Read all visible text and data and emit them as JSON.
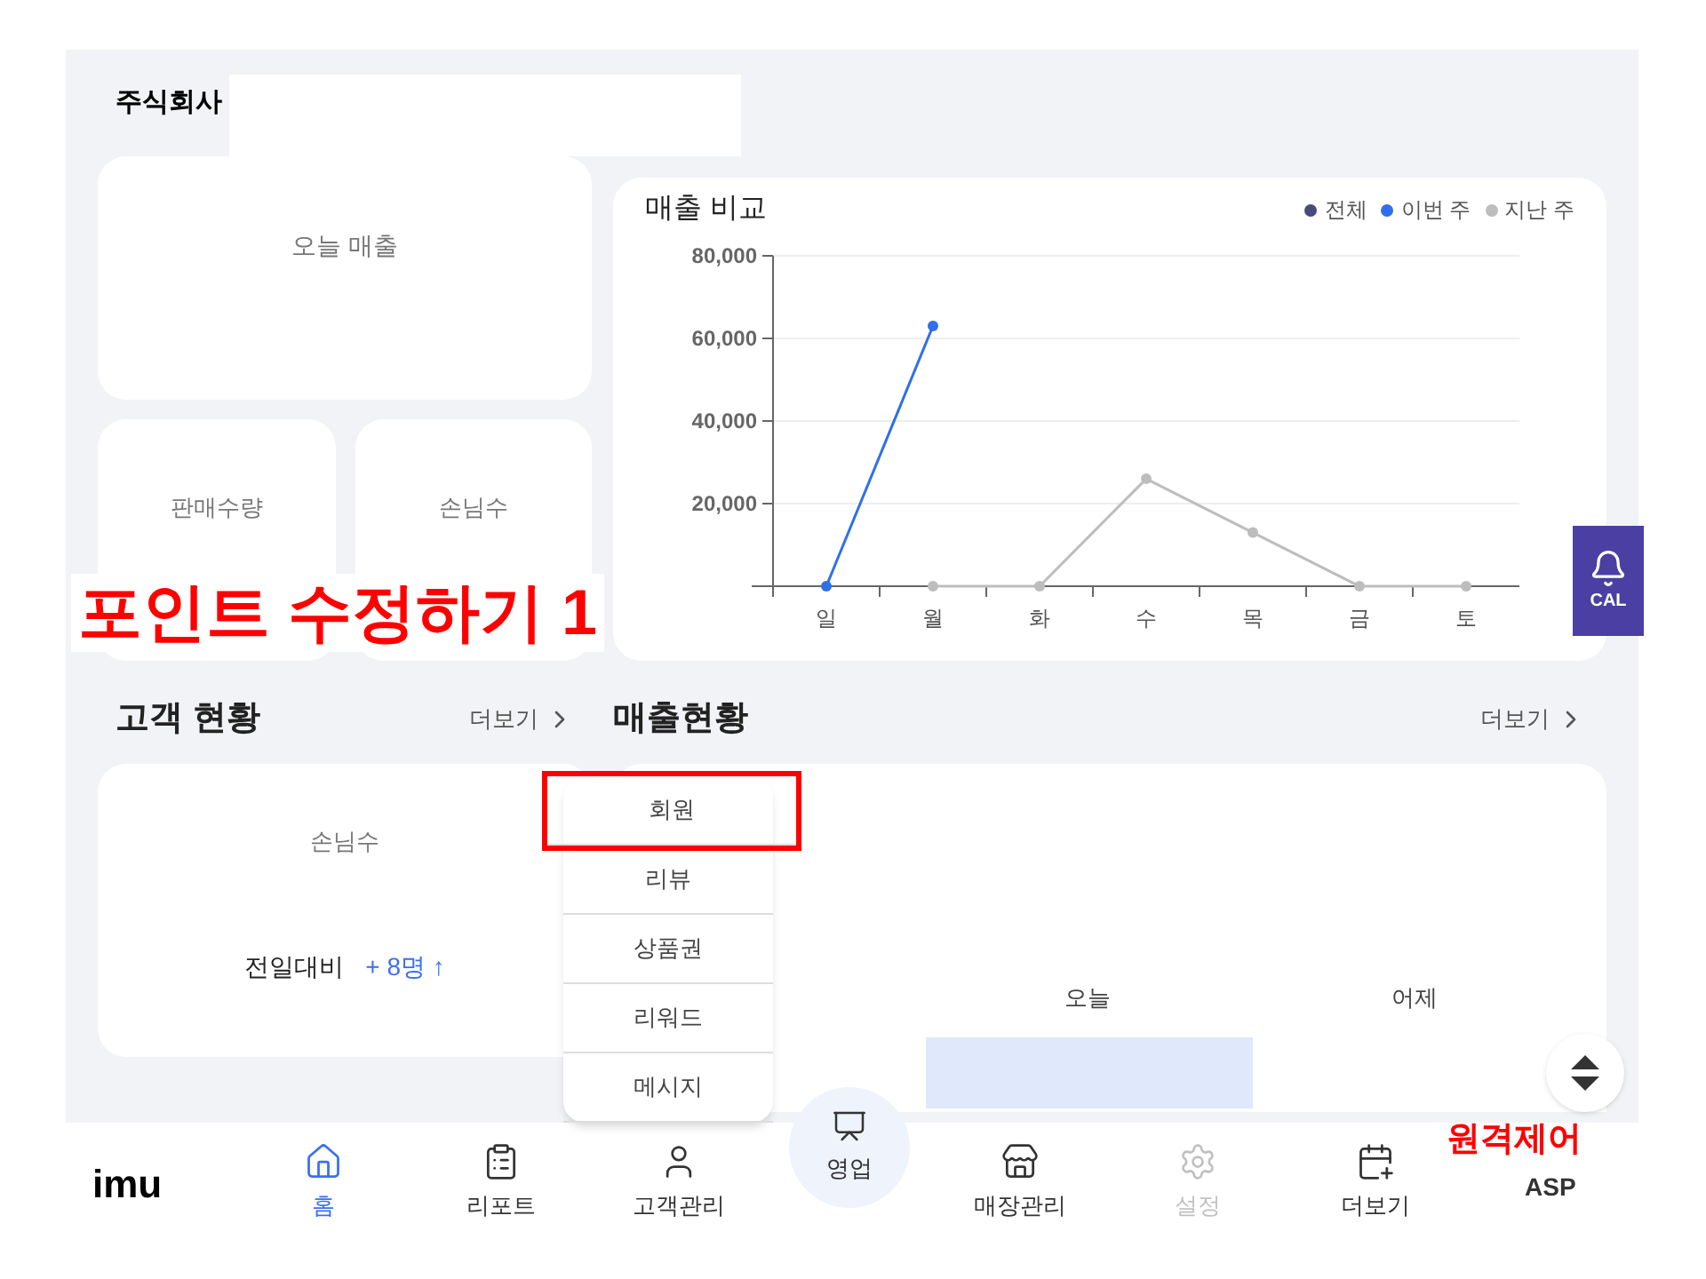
{
  "header": {
    "title": "주식회사"
  },
  "summary_cards": [
    {
      "label": "오늘 매출",
      "kind": "wide"
    },
    {
      "label": "판매수량",
      "kind": "small"
    },
    {
      "label": "손님수",
      "kind": "small"
    }
  ],
  "annotations": [
    {
      "text": "포인트 수정하기 1",
      "kind": "large"
    },
    {
      "text": "원격제어",
      "kind": "edge"
    }
  ],
  "sales_chart": {
    "title": "매출 비교",
    "chart_data": {
      "type": "line",
      "grid": true,
      "categories": [
        "일",
        "월",
        "화",
        "수",
        "목",
        "금",
        "토"
      ],
      "series": [
        {
          "name": "전체",
          "color": "#4a4a7a",
          "values": [
            null,
            null,
            null,
            null,
            null,
            null,
            null
          ]
        },
        {
          "name": "이번 주",
          "color": "#2f6fea",
          "marker": true,
          "values": [
            0,
            63000,
            null,
            null,
            null,
            null,
            null
          ]
        },
        {
          "name": "지난 주",
          "color": "#bdbdbd",
          "marker": true,
          "values": [
            null,
            0,
            0,
            26000,
            13000,
            0,
            0
          ]
        }
      ],
      "ylim": [
        0,
        80000
      ],
      "yticks": [
        {
          "value": 20000,
          "label": "20,000"
        },
        {
          "value": 40000,
          "label": "40,000"
        },
        {
          "value": 60000,
          "label": "60,000"
        },
        {
          "value": 80000,
          "label": "80,000"
        }
      ]
    }
  },
  "customer_section": {
    "title": "고객 현황",
    "more": "더보기",
    "label": "손님수",
    "compare_label": "전일대비",
    "compare_value": "+ 8명 ↑"
  },
  "sales_section": {
    "title": "매출현황",
    "more": "더보기",
    "columns": [
      "오늘",
      "어제"
    ]
  },
  "popup_menu": [
    {
      "label": "회원",
      "selected": true
    },
    {
      "label": "리뷰",
      "selected": false
    },
    {
      "label": "상품권",
      "selected": false
    },
    {
      "label": "리워드",
      "selected": false
    },
    {
      "label": "메시지",
      "selected": false
    }
  ],
  "call_button": {
    "label": "CAL"
  },
  "bottom_nav": {
    "logo": "imu",
    "items": [
      {
        "label": "홈",
        "selected": true,
        "disabled": false
      },
      {
        "label": "리포트",
        "selected": false,
        "disabled": false
      },
      {
        "label": "고객관리",
        "selected": false,
        "disabled": false
      },
      {
        "label": "영업",
        "selected": false,
        "disabled": false,
        "kind": "center"
      },
      {
        "label": "매장관리",
        "selected": false,
        "disabled": false
      },
      {
        "label": "설정",
        "selected": false,
        "disabled": true
      },
      {
        "label": "더보기",
        "selected": false,
        "disabled": false
      },
      {
        "label": "ASP",
        "selected": false,
        "disabled": false,
        "kind": "text"
      }
    ]
  }
}
